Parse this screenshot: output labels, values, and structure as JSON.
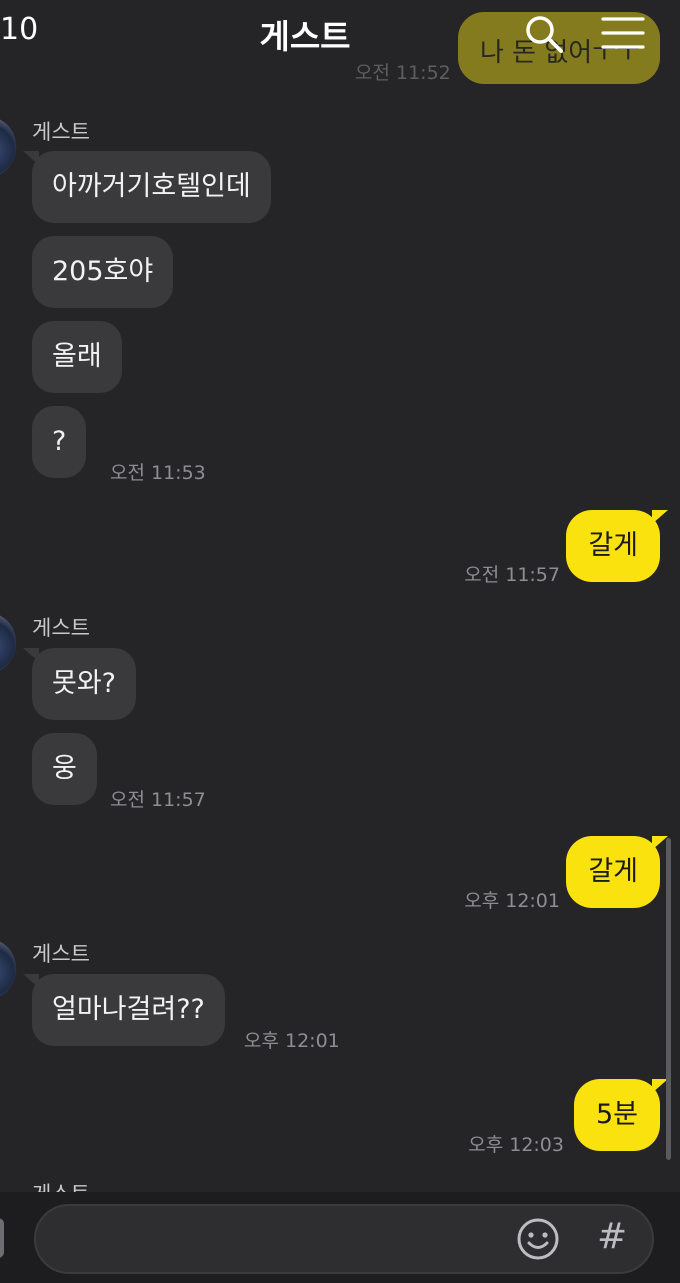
{
  "header": {
    "back_count": "10",
    "title": "게스트",
    "prev_bubble_text": "나 돈 없어ㅜㅜ",
    "prev_time": "오전 11:52"
  },
  "messages": {
    "g1": {
      "sender": "게스트",
      "lines": [
        "아까거기호텔인데",
        "205호야",
        "올래",
        "?"
      ],
      "time": "오전 11:53"
    },
    "m1": {
      "text": "갈게",
      "time": "오전 11:57"
    },
    "g2": {
      "sender": "게스트",
      "lines": [
        "못와?",
        "웅"
      ],
      "time": "오전 11:57"
    },
    "m2": {
      "text": "갈게",
      "time": "오후 12:01"
    },
    "g3": {
      "sender": "게스트",
      "lines": [
        "얼마나걸려??"
      ],
      "time": "오후 12:01"
    },
    "m3": {
      "text": "5분",
      "time": "오후 12:03"
    },
    "g4": {
      "sender": "게스트"
    }
  },
  "input": {
    "hash_label": "#"
  },
  "icons": [
    "search-icon",
    "menu-icon",
    "emoji-icon",
    "hash-icon"
  ],
  "colors": {
    "background": "#252528",
    "my_bubble": "#f9e20e",
    "other_bubble": "#3a3a3d"
  }
}
